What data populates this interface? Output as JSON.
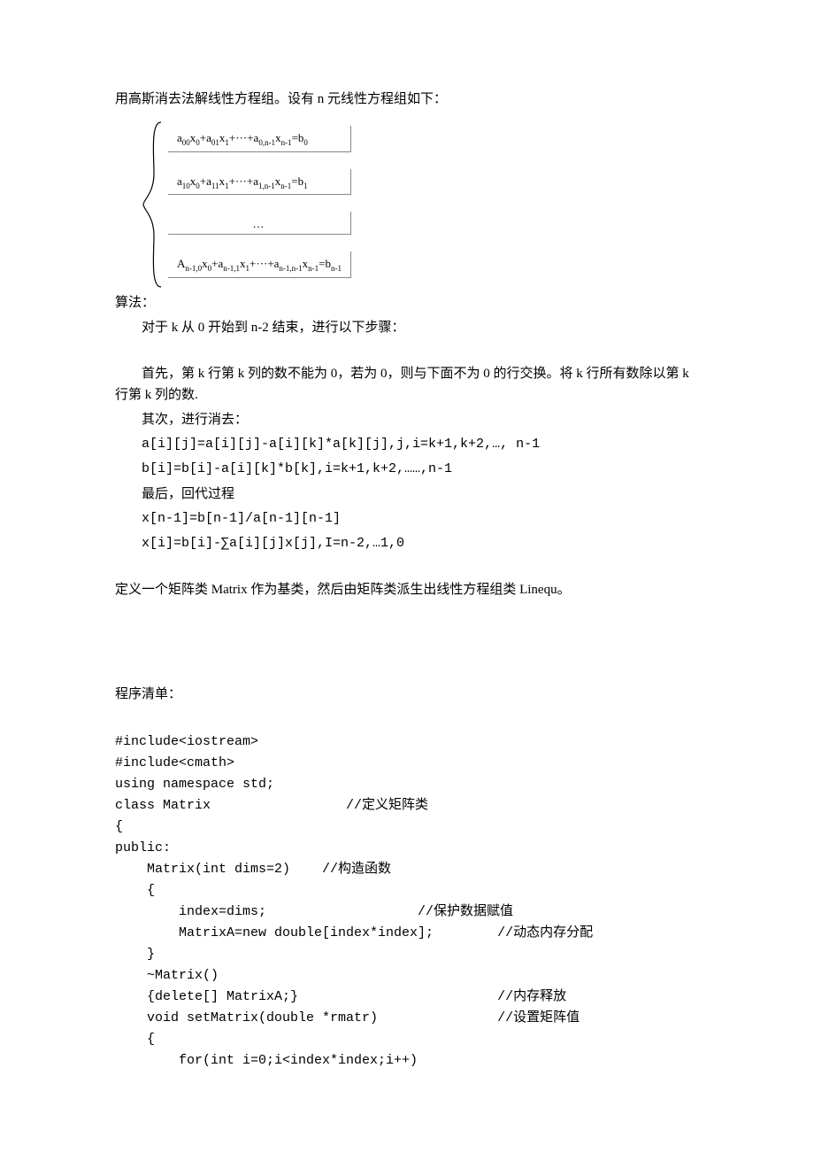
{
  "intro": "用高斯消去法解线性方程组。设有 n 元线性方程组如下：",
  "eq": {
    "row1_html": "a<sub>00</sub>x<sub>0</sub>+a<sub>01</sub>x<sub>1</sub>+···+a<sub>0,n-1</sub>x<sub>n-1</sub>=b<sub>0</sub>",
    "row2_html": "a<sub>10</sub>x<sub>0</sub>+a<sub>11</sub>x<sub>1</sub>+···+a<sub>1,n-1</sub>x<sub>n-1</sub>=b<sub>1</sub>",
    "row3": "…",
    "row4_html": "A<sub>n-1,0</sub>x<sub>0</sub>+a<sub>n-1,1</sub>x<sub>1</sub>+···+a<sub>n-1,n-1</sub>x<sub>n-1</sub>=b<sub>n-1</sub>"
  },
  "algo_title": "算法：",
  "algo_step": "对于 k 从 0 开始到 n-2 结束，进行以下步骤：",
  "algo_first": "首先，第 k 行第 k 列的数不能为 0，若为 0，则与下面不为 0 的行交换。将 k 行所有数除以第 k 行第 k 列的数.",
  "algo_second": "其次，进行消去：",
  "algo_formula1": "a[i][j]=a[i][j]-a[i][k]*a[k][j],j,i=k+1,k+2,…, n-1",
  "algo_formula2": "b[i]=b[i]-a[i][k]*b[k],i=k+1,k+2,……,n-1",
  "algo_last": "最后，回代过程",
  "algo_formula3": "x[n-1]=b[n-1]/a[n-1][n-1]",
  "algo_formula4": "x[i]=b[i]-∑a[i][j]x[j],I=n-2,…1,0",
  "class_desc": "定义一个矩阵类 Matrix 作为基类，然后由矩阵类派生出线性方程组类 Linequ。",
  "code_title": "程序清单：",
  "code": {
    "l01": "#include<iostream>",
    "l02": "#include<cmath>",
    "l03": "using namespace std;",
    "l04": "class Matrix                 //定义矩阵类",
    "l05": "{",
    "l06": "public:",
    "l07": "    Matrix(int dims=2)    //构造函数",
    "l08": "    {",
    "l09": "        index=dims;                   //保护数据赋值",
    "l10": "        MatrixA=new double[index*index];        //动态内存分配",
    "l11": "    }",
    "l12": "    ~Matrix()",
    "l13": "    {delete[] MatrixA;}                         //内存释放",
    "l14": "    void setMatrix(double *rmatr)               //设置矩阵值",
    "l15": "    {",
    "l16": "        for(int i=0;i<index*index;i++)"
  }
}
